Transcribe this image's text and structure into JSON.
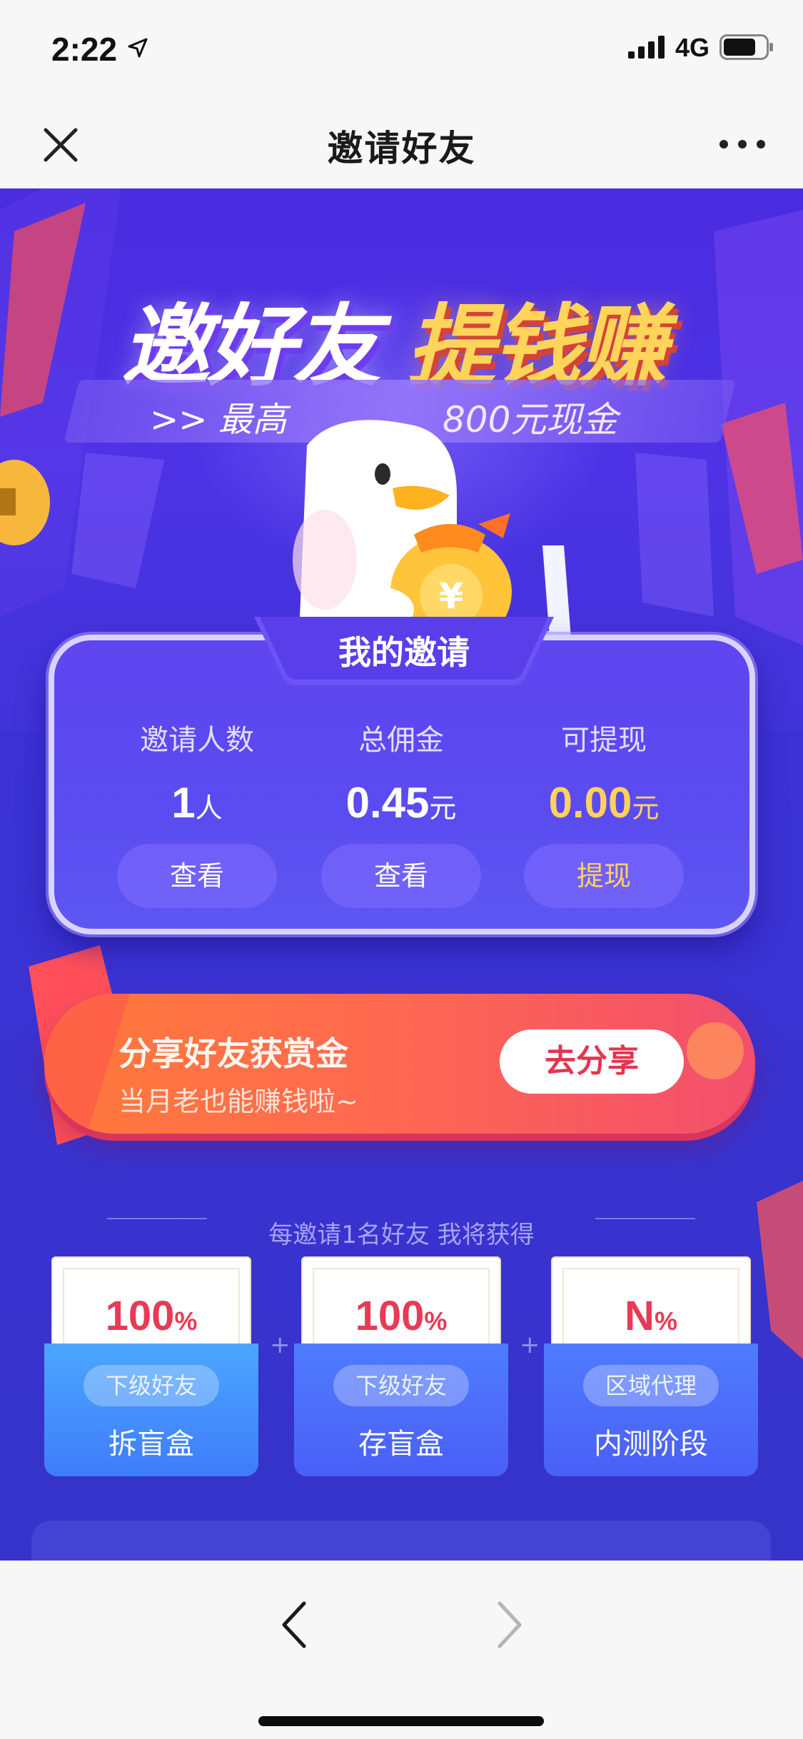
{
  "status_bar": {
    "time": "2:22",
    "network": "4G",
    "icons": [
      "location-arrow-icon",
      "signal-bars-icon",
      "battery-icon"
    ]
  },
  "nav": {
    "title": "邀请好友",
    "close_icon": "close-icon",
    "more_icon": "more-dots-icon"
  },
  "hero": {
    "title_left": "邀好友",
    "title_right": "提钱赚",
    "subtitle_left": ">> 最高",
    "subtitle_right": "800元现金"
  },
  "my_invite": {
    "tab_label": "我的邀请",
    "stats": [
      {
        "label": "邀请人数",
        "value": "1",
        "unit": "人",
        "button": "查看"
      },
      {
        "label": "总佣金",
        "value": "0.45",
        "unit": "元",
        "button": "查看"
      },
      {
        "label": "可提现",
        "value": "0.00",
        "unit": "元",
        "button": "提现"
      }
    ]
  },
  "share": {
    "title": "分享好友获赏金",
    "subtitle": "当月老也能赚钱啦~",
    "button": "去分享"
  },
  "rewards": {
    "heading": "每邀请1名好友 我将获得",
    "plus": "+",
    "items": [
      {
        "percent": "100",
        "symbol": "%",
        "tag": "下级好友",
        "name": "拆盲盒"
      },
      {
        "percent": "100",
        "symbol": "%",
        "tag": "下级好友",
        "name": "存盲盒"
      },
      {
        "percent": "N",
        "symbol": "%",
        "tag": "区域代理",
        "name": "内测阶段"
      }
    ]
  },
  "toolbar": {
    "back_icon": "chevron-left-icon",
    "forward_icon": "chevron-right-icon"
  },
  "colors": {
    "page_bg": "#3d2fd9",
    "accent_gold": "#ffd25c",
    "share_orange": "#ff7a3a",
    "share_pink": "#f34f6c",
    "reward_red": "#e83a57",
    "box_blue": "#3e7dfa"
  }
}
